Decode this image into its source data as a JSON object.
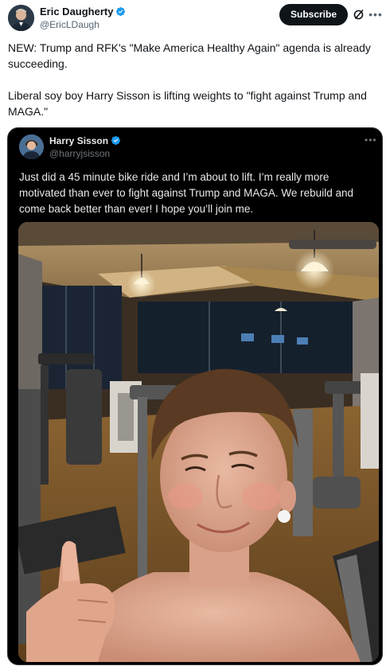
{
  "post": {
    "author_name": "Eric Daugherty",
    "author_handle": "@EricLDaugh",
    "subscribe_label": "Subscribe",
    "paragraphs": [
      "NEW: Trump and RFK's \"Make America Healthy Again\" agenda is already succeeding.",
      "Liberal soy boy Harry Sisson is lifting weights to \"fight against Trump and MAGA.\""
    ],
    "icons": {
      "verified": "verified-badge-icon",
      "grok": "grok-icon",
      "more": "more-icon"
    }
  },
  "quote": {
    "author_name": "Harry Sisson",
    "author_handle": "@harryjsisson",
    "text": "Just did a 45 minute bike ride and I’m about to lift. I’m really more motivated than ever to fight against Trump and MAGA. We rebuild and come back better than ever! I hope you’ll join me.",
    "media_description_icon": "gym-selfie-photo"
  },
  "colors": {
    "verified_blue": "#1d9bf0",
    "text_primary": "#0f1419",
    "text_secondary": "#536471",
    "quote_bg": "#000000",
    "quote_text": "#e7e9ea"
  }
}
